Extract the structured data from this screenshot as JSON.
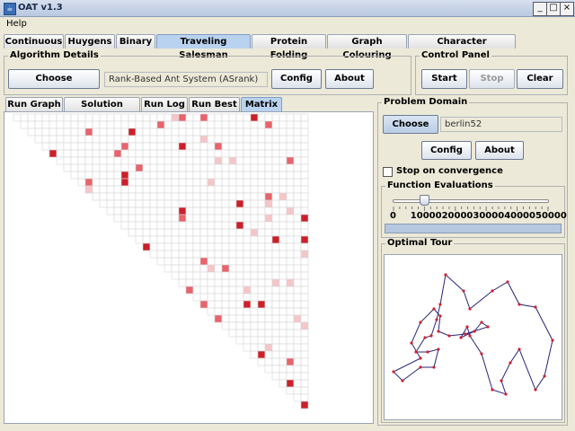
{
  "window": {
    "title": "OAT v1.3"
  },
  "menu": {
    "help": "Help"
  },
  "tabs": [
    {
      "label": "Continuous"
    },
    {
      "label": "Huygens"
    },
    {
      "label": "Binary"
    },
    {
      "label": "Traveling Salesman",
      "active": true
    },
    {
      "label": "Protein Folding"
    },
    {
      "label": "Graph Colouring"
    },
    {
      "label": "Character Recognition"
    }
  ],
  "algorithm": {
    "title": "Algorithm Details",
    "choose": "Choose",
    "name": "Rank-Based Ant System (ASrank)",
    "config": "Config",
    "about": "About"
  },
  "control": {
    "title": "Control Panel",
    "start": "Start",
    "stop": "Stop",
    "clear": "Clear"
  },
  "subtabs": [
    {
      "label": "Run Graph"
    },
    {
      "label": "Solution Quality"
    },
    {
      "label": "Run Log"
    },
    {
      "label": "Run Best"
    },
    {
      "label": "Matrix",
      "active": true
    }
  ],
  "problem": {
    "title": "Problem Domain",
    "choose": "Choose",
    "name": "berlin52",
    "config": "Config",
    "about": "About",
    "stop_convergence": "Stop on convergence"
  },
  "evaluations": {
    "title": "Function Evaluations",
    "ticks": [
      "0",
      "10000",
      "20000",
      "30000",
      "40000",
      "50000"
    ],
    "value": 10000,
    "max": 50000
  },
  "tour": {
    "title": "Optimal Tour"
  },
  "colors": {
    "accent": "#b9d2ef",
    "pheromone_strong": "#cc1f2a",
    "pheromone_weak": "#f5c6c8",
    "tour_line": "#25257a"
  }
}
